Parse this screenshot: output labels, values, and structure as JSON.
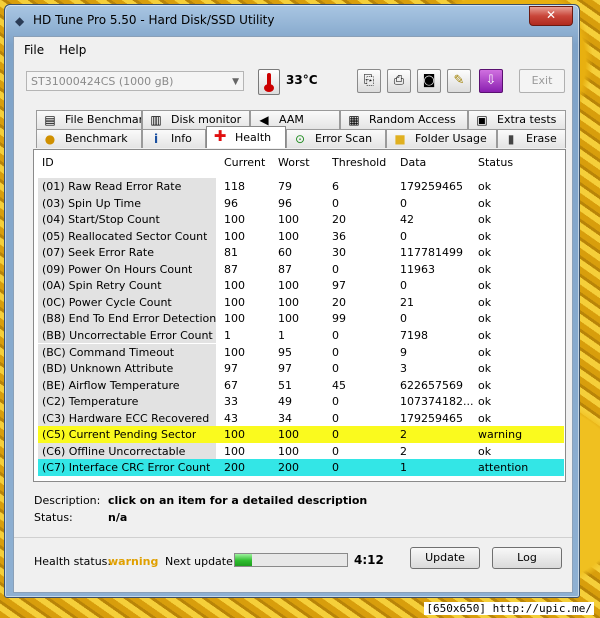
{
  "window": {
    "title": "HD Tune Pro 5.50 - Hard Disk/SSD Utility",
    "close_label": "✕"
  },
  "menu": [
    "File",
    "Help"
  ],
  "toolbar": {
    "drive": "ST31000424CS (1000 gB)",
    "temperature": "33°C",
    "exit_label": "Exit"
  },
  "tabs_top": [
    "File Benchmark",
    "Disk monitor",
    "AAM",
    "Random Access",
    "Extra tests"
  ],
  "tabs_bottom": [
    "Benchmark",
    "Info",
    "Health",
    "Error Scan",
    "Folder Usage",
    "Erase"
  ],
  "active_tab": "Health",
  "table": {
    "headers": [
      "ID",
      "Current",
      "Worst",
      "Threshold",
      "Data",
      "Status"
    ],
    "rows": [
      [
        "(01) Raw Read Error Rate",
        "118",
        "79",
        "6",
        "179259465",
        "ok"
      ],
      [
        "(03) Spin Up Time",
        "96",
        "96",
        "0",
        "0",
        "ok"
      ],
      [
        "(04) Start/Stop Count",
        "100",
        "100",
        "20",
        "42",
        "ok"
      ],
      [
        "(05) Reallocated Sector Count",
        "100",
        "100",
        "36",
        "0",
        "ok"
      ],
      [
        "(07) Seek Error Rate",
        "81",
        "60",
        "30",
        "117781499",
        "ok"
      ],
      [
        "(09) Power On Hours Count",
        "87",
        "87",
        "0",
        "11963",
        "ok"
      ],
      [
        "(0A) Spin Retry Count",
        "100",
        "100",
        "97",
        "0",
        "ok"
      ],
      [
        "(0C) Power Cycle Count",
        "100",
        "100",
        "20",
        "21",
        "ok"
      ],
      [
        "(B8) End To End Error Detection",
        "100",
        "100",
        "99",
        "0",
        "ok"
      ],
      [
        "(BB) Uncorrectable Error Count",
        "1",
        "1",
        "0",
        "7198",
        "ok"
      ],
      [
        "(BC) Command Timeout",
        "100",
        "95",
        "0",
        "9",
        "ok"
      ],
      [
        "(BD) Unknown Attribute",
        "97",
        "97",
        "0",
        "3",
        "ok"
      ],
      [
        "(BE) Airflow Temperature",
        "67",
        "51",
        "45",
        "622657569",
        "ok"
      ],
      [
        "(C2) Temperature",
        "33",
        "49",
        "0",
        "107374182...",
        "ok"
      ],
      [
        "(C3) Hardware ECC Recovered",
        "43",
        "34",
        "0",
        "179259465",
        "ok"
      ],
      [
        "(C5) Current Pending Sector",
        "100",
        "100",
        "0",
        "2",
        "warning"
      ],
      [
        "(C6) Offline Uncorrectable",
        "100",
        "100",
        "0",
        "2",
        "ok"
      ],
      [
        "(C7) Interface CRC Error Count",
        "200",
        "200",
        "0",
        "1",
        "attention"
      ]
    ],
    "highlight": {
      "15": "#fafa1e",
      "17": "#33e6e6"
    }
  },
  "description": {
    "label": "Description:",
    "value": "click on an item for a detailed description"
  },
  "status": {
    "label": "Status:",
    "value": "n/a"
  },
  "footer": {
    "health_label": "Health status:",
    "health_value": "warning",
    "next_update_label": "Next update:",
    "next_update_progress": 0.15,
    "next_update_time": "4:12",
    "update_label": "Update",
    "log_label": "Log"
  },
  "watermark": "[650x650] http://upic.me/"
}
